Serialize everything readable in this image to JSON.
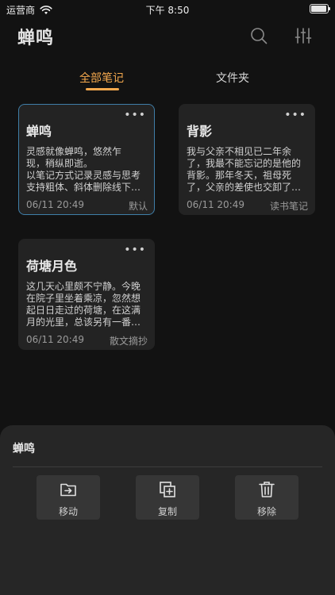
{
  "status_bar": {
    "carrier": "运营商",
    "time": "下午 8:50",
    "battery_level": 0.95
  },
  "header": {
    "title": "蝉鸣",
    "search_icon": "search-icon",
    "filter_icon": "sliders-icon"
  },
  "tabs": [
    {
      "label": "全部笔记",
      "active": true
    },
    {
      "label": "文件夹",
      "active": false
    }
  ],
  "notes": [
    {
      "title": "蝉鸣",
      "lines": [
        "灵感就像蝉鸣，悠然乍",
        "现，稍纵即逝。",
        "以笔记方式记录灵感与思考",
        "支持粗体、斜体删除线下…"
      ],
      "date": "06/11 20:49",
      "folder": "默认",
      "selected": true
    },
    {
      "title": "背影",
      "lines": [
        "我与父亲不相见已二年余",
        "了，我最不能忘记的是他的",
        "背影。那年冬天，祖母死",
        "了，父亲的差使也交卸了…"
      ],
      "date": "06/11 20:49",
      "folder": "读书笔记",
      "selected": false
    },
    {
      "title": "荷塘月色",
      "lines": [
        "这几天心里颇不宁静。今晚",
        "在院子里坐着乘凉，忽然想",
        "起日日走过的荷塘，在这满",
        "月的光里，总该另有一番…"
      ],
      "date": "06/11 20:49",
      "folder": "散文摘抄",
      "selected": false
    }
  ],
  "more_label": "•••",
  "sheet": {
    "title": "蝉鸣",
    "actions": [
      {
        "label": "移动",
        "icon": "folder-move-icon"
      },
      {
        "label": "复制",
        "icon": "copy-icon"
      },
      {
        "label": "移除",
        "icon": "trash-icon"
      }
    ]
  },
  "colors": {
    "accent": "#f5a94e",
    "selected_border": "#3f7ea8",
    "background": "#121212",
    "card": "#232323",
    "sheet": "#262626"
  }
}
